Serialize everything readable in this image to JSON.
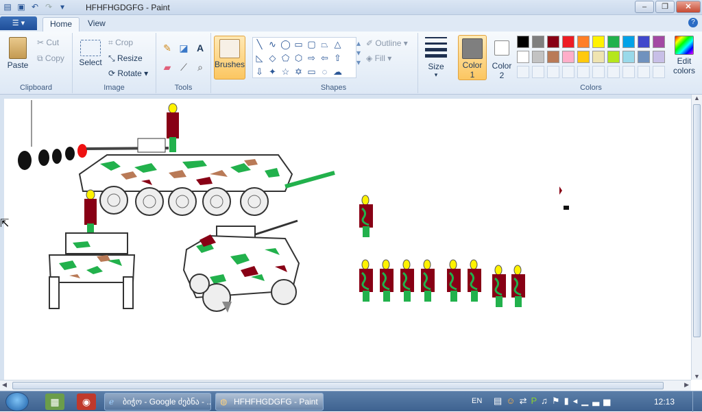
{
  "window": {
    "title": "HFHFHGDGFG - Paint",
    "min": "–",
    "max": "❐",
    "close": "✕"
  },
  "quick_access": {
    "app_icon": "paint-app-icon",
    "save_icon": "save-icon",
    "undo_icon": "undo-icon",
    "redo_icon": "redo-icon",
    "customize_icon": "chevron-down-icon"
  },
  "tabs": {
    "file_icon": "menu-icon",
    "home": "Home",
    "view": "View",
    "help": "?"
  },
  "clipboard": {
    "paste": "Paste",
    "cut": "Cut",
    "copy": "Copy",
    "label": "Clipboard"
  },
  "image": {
    "select": "Select",
    "crop": "Crop",
    "resize": "Resize",
    "rotate": "Rotate",
    "label": "Image"
  },
  "tools": {
    "label": "Tools"
  },
  "brushes": {
    "label": "Brushes"
  },
  "shapes": {
    "outline": "Outline",
    "fill": "Fill",
    "label": "Shapes"
  },
  "size": {
    "label": "Size"
  },
  "color1": {
    "label": "Color",
    "num": "1",
    "color": "#7f7f7f"
  },
  "color2": {
    "label": "Color",
    "num": "2",
    "color": "#ffffff"
  },
  "colors": {
    "label": "Colors",
    "row1": [
      "#000000",
      "#7f7f7f",
      "#880015",
      "#ed1c24",
      "#ff7f27",
      "#fff200",
      "#22b14c",
      "#00a2e8",
      "#3f48cc",
      "#a349a4"
    ],
    "row2": [
      "#ffffff",
      "#c3c3c3",
      "#b97a57",
      "#ffaec9",
      "#ffc90e",
      "#efe4b0",
      "#b5e61d",
      "#99d9ea",
      "#7092be",
      "#c8bfe7"
    ],
    "edit": "Edit",
    "edit2": "colors"
  },
  "taskbar": {
    "items": [
      {
        "label": "ბიჭო - Google ძებნა - ...",
        "icon": "ie-icon"
      },
      {
        "label": "HFHFHGDGFG - Paint",
        "icon": "paint-icon"
      }
    ],
    "lang": "EN",
    "clock": "12:13"
  }
}
